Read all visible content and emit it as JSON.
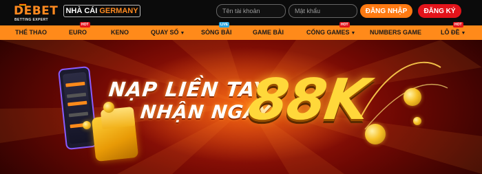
{
  "header": {
    "logo_text": "DEBET",
    "logo_subtext": "BETTING EXPERT",
    "brand_prefix": "NHÀ CÁI ",
    "brand_highlight": "GERMANY",
    "username_placeholder": "Tên tài khoản",
    "password_placeholder": "Mật khẩu",
    "login_label": "ĐĂNG NHẬP",
    "register_label": "ĐĂNG KÝ"
  },
  "nav": {
    "items": [
      {
        "label": "THỂ THAO"
      },
      {
        "label": "EURO",
        "badge": "HOT"
      },
      {
        "label": "KENO"
      },
      {
        "label": "QUAY SỐ",
        "chevron": "chevron-down-icon"
      },
      {
        "label": "SÒNG BÀI",
        "badge": "LIVE"
      },
      {
        "label": "GAME BÀI"
      },
      {
        "label": "CỔNG GAMES",
        "badge": "HOT",
        "chevron": "chevron-down-icon"
      },
      {
        "label": "NUMBERS GAME"
      },
      {
        "label": "LÔ ĐỀ",
        "badge": "HOT",
        "chevron": "chevron-down-icon"
      }
    ]
  },
  "banner": {
    "line1": "NẠP LIỀN TAY",
    "line2": "NHẬN NGAY",
    "amount": "88K"
  },
  "colors": {
    "accent_orange": "#ff8a1a",
    "register_red": "#e3141b",
    "gold": "#ffd83a"
  }
}
